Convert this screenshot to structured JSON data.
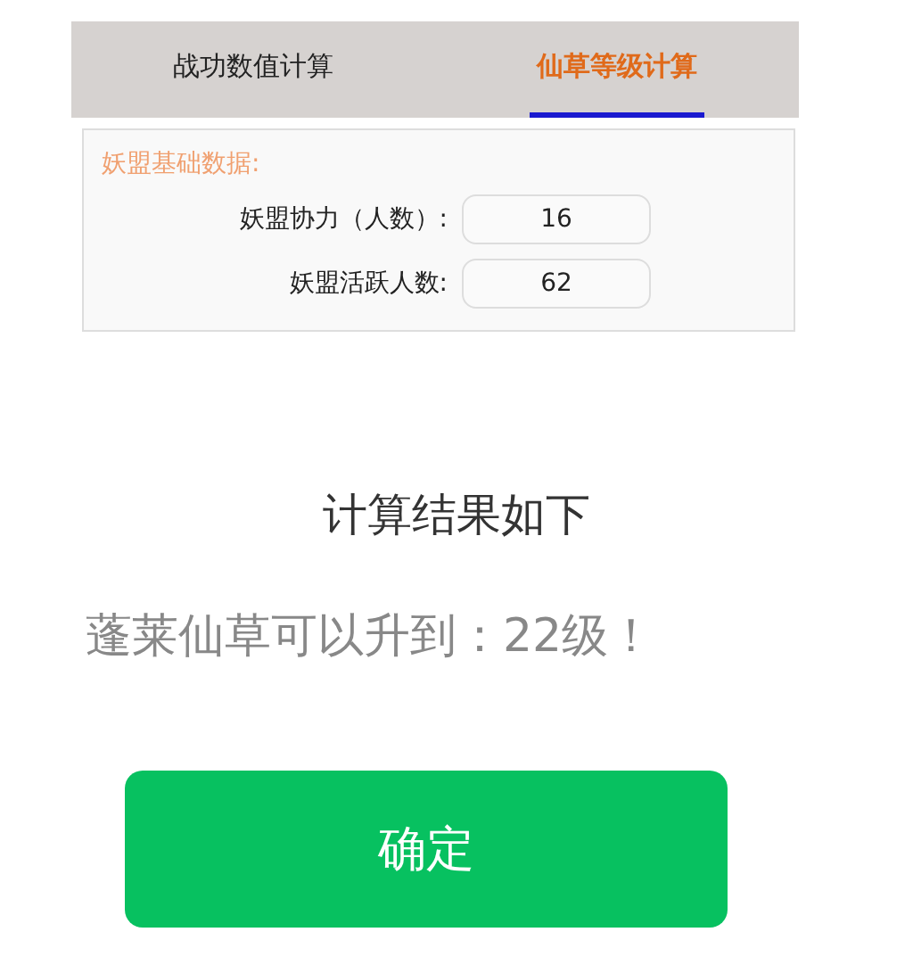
{
  "tabs": [
    {
      "label": "战功数值计算",
      "selected": false
    },
    {
      "label": "仙草等级计算",
      "selected": true
    }
  ],
  "form": {
    "section_title": "妖盟基础数据:",
    "fields": [
      {
        "label": "妖盟协力（人数）:",
        "value": "16"
      },
      {
        "label": "妖盟活跃人数:",
        "value": "62"
      }
    ]
  },
  "result": {
    "title": "计算结果如下",
    "message": "蓬莱仙草可以升到：22级！"
  },
  "confirm_button": "确定"
}
